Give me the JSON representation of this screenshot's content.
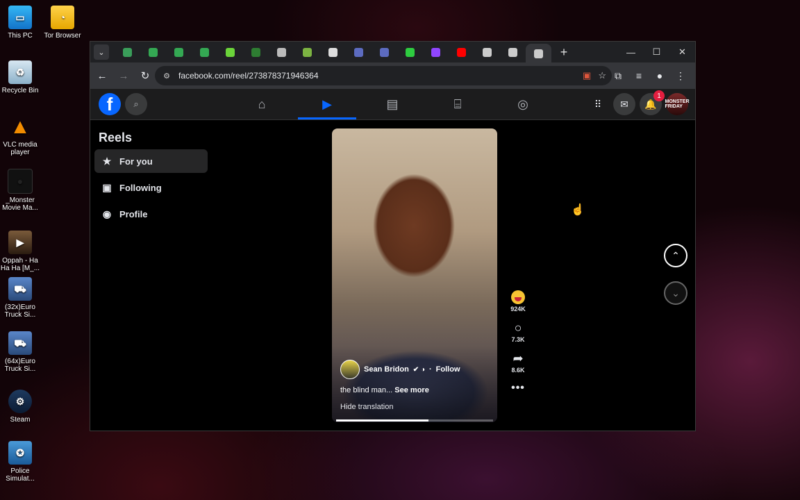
{
  "desktop": {
    "icons": [
      {
        "label": "This PC",
        "glyph": "▭"
      },
      {
        "label": "Tor Browser",
        "glyph": "◔"
      },
      {
        "label": "Recycle Bin",
        "glyph": "♻"
      },
      {
        "label": "VLC media player",
        "glyph": "▲"
      },
      {
        "label": "_Monster Movie Ma...",
        "glyph": "●"
      },
      {
        "label": "Oppah - Ha Ha Ha [M_...",
        "glyph": "▶"
      },
      {
        "label": "(32x)Euro Truck Si...",
        "glyph": "⛟"
      },
      {
        "label": "(64x)Euro Truck Si...",
        "glyph": "⛟"
      },
      {
        "label": "Steam",
        "glyph": "⚙"
      },
      {
        "label": "Police Simulat...",
        "glyph": "✪"
      }
    ]
  },
  "browser": {
    "url": "facebook.com/reel/273878371946364",
    "tab_favicons": [
      "#3a9e5a",
      "#34a853",
      "#34a853",
      "#34a853",
      "#6bd43a",
      "#2e7d32",
      "#bbb",
      "#7cb342",
      "#ddd",
      "#5c6bc0",
      "#5c6bc0",
      "#2ecc40",
      "#9146ff",
      "#ff0000",
      "#ccc",
      "#ccc",
      "#ccc"
    ],
    "controls": {
      "minimize": "—",
      "maximize": "☐",
      "close": "✕"
    }
  },
  "fb": {
    "logo": "f",
    "notifications_count": "1",
    "avatar_text": "MONSTER FRIDAY"
  },
  "sidebar": {
    "title": "Reels",
    "items": [
      {
        "label": "For you",
        "icon": "star-icon",
        "glyph": "★"
      },
      {
        "label": "Following",
        "icon": "following-icon",
        "glyph": "▣"
      },
      {
        "label": "Profile",
        "icon": "profile-icon",
        "glyph": "◉"
      }
    ]
  },
  "reel": {
    "author": "Sean Bridon",
    "follow": "Follow",
    "caption": "the blind man...",
    "see_more": "See more",
    "hide_translation": "Hide translation",
    "progress": 0.59
  },
  "actions": {
    "reactions_count": "924K",
    "comments_count": "7.3K",
    "shares_count": "8.6K",
    "more": "•••"
  }
}
